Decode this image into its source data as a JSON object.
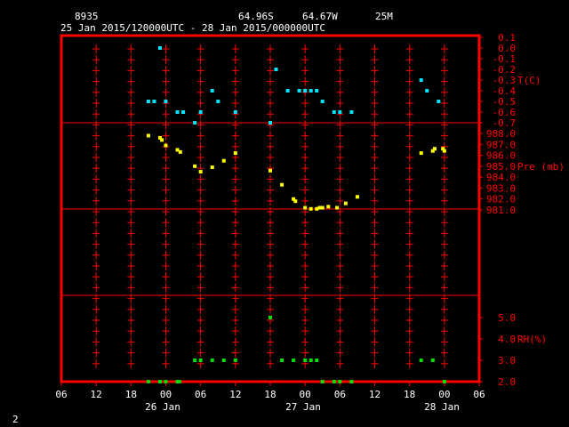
{
  "header": {
    "station": "8935",
    "lat": "64.96S",
    "lon": "64.67W",
    "elev": "25M",
    "range": "25 Jan 2015/120000UTC - 28 Jan 2015/000000UTC"
  },
  "footer": {
    "page": "2"
  },
  "colors": {
    "axes": "#ff0000",
    "text": "#ffffff",
    "temp": "#00e5ff",
    "pres": "#ffff00",
    "rh": "#00e000"
  },
  "chart_data": [
    {
      "type": "scatter",
      "panel": "temperature",
      "ylabel": "T(C)",
      "ylim": [
        -0.7,
        0.1
      ],
      "ticks": [
        "0.1",
        "0.0",
        "-0.1",
        "-0.2",
        "-0.3",
        "-0.4",
        "-0.5",
        "-0.6",
        "-0.7"
      ],
      "x": [
        "2015-01-25T21:00",
        "2015-01-25T22:00",
        "2015-01-25T23:00",
        "2015-01-26T00:00",
        "2015-01-26T02:00",
        "2015-01-26T03:00",
        "2015-01-26T05:00",
        "2015-01-26T06:00",
        "2015-01-26T08:00",
        "2015-01-26T09:00",
        "2015-01-26T12:00",
        "2015-01-26T18:00",
        "2015-01-26T19:00",
        "2015-01-26T21:00",
        "2015-01-26T23:00",
        "2015-01-27T00:00",
        "2015-01-27T01:00",
        "2015-01-27T02:00",
        "2015-01-27T03:00",
        "2015-01-27T05:00",
        "2015-01-27T06:00",
        "2015-01-27T08:00",
        "2015-01-27T20:00",
        "2015-01-27T21:00",
        "2015-01-27T23:00"
      ],
      "values": [
        -0.5,
        -0.5,
        0.0,
        -0.5,
        -0.6,
        -0.6,
        -0.7,
        -0.6,
        -0.4,
        -0.5,
        -0.6,
        -0.7,
        -0.2,
        -0.4,
        -0.4,
        -0.4,
        -0.4,
        -0.4,
        -0.5,
        -0.6,
        -0.6,
        -0.6,
        -0.3,
        -0.4,
        -0.5
      ]
    },
    {
      "type": "scatter",
      "panel": "pressure",
      "ylabel": "Pre (mb)",
      "ylim": [
        981.0,
        988.0
      ],
      "ticks": [
        "988.0",
        "987.0",
        "986.0",
        "985.0",
        "984.0",
        "983.0",
        "982.0",
        "981.0"
      ],
      "x": [
        "2015-01-25T21:00",
        "2015-01-25T23:00",
        "2015-01-25T23:20",
        "2015-01-26T00:00",
        "2015-01-26T02:00",
        "2015-01-26T02:30",
        "2015-01-26T05:00",
        "2015-01-26T06:00",
        "2015-01-26T08:00",
        "2015-01-26T10:00",
        "2015-01-26T12:00",
        "2015-01-26T18:00",
        "2015-01-26T20:00",
        "2015-01-26T22:00",
        "2015-01-26T22:20",
        "2015-01-27T00:00",
        "2015-01-27T01:00",
        "2015-01-27T02:00",
        "2015-01-27T02:30",
        "2015-01-27T03:00",
        "2015-01-27T04:00",
        "2015-01-27T05:30",
        "2015-01-27T07:00",
        "2015-01-27T09:00",
        "2015-01-27T20:00",
        "2015-01-27T22:00",
        "2015-01-27T22:20",
        "2015-01-27T23:45",
        "2015-01-28T00:00"
      ],
      "values": [
        987.8,
        987.6,
        987.4,
        986.9,
        986.5,
        986.3,
        985.0,
        984.5,
        984.9,
        985.5,
        986.2,
        984.6,
        983.3,
        982.0,
        981.8,
        981.2,
        981.1,
        981.1,
        981.2,
        981.2,
        981.3,
        981.2,
        981.6,
        982.2,
        986.2,
        986.4,
        986.6,
        986.6,
        986.4
      ]
    },
    {
      "type": "scatter",
      "panel": "relative humidity",
      "ylabel": "RH(%)",
      "ylim": [
        2.0,
        5.0
      ],
      "ticks": [
        "5.0",
        "4.0",
        "3.0",
        "2.0"
      ],
      "x": [
        "2015-01-25T21:00",
        "2015-01-25T23:00",
        "2015-01-26T00:00",
        "2015-01-26T02:00",
        "2015-01-26T02:20",
        "2015-01-26T05:00",
        "2015-01-26T06:00",
        "2015-01-26T08:00",
        "2015-01-26T10:00",
        "2015-01-26T12:00",
        "2015-01-26T18:00",
        "2015-01-26T20:00",
        "2015-01-26T22:00",
        "2015-01-27T00:00",
        "2015-01-27T01:00",
        "2015-01-27T02:00",
        "2015-01-27T03:00",
        "2015-01-27T05:00",
        "2015-01-27T06:00",
        "2015-01-27T08:00",
        "2015-01-27T20:00",
        "2015-01-27T22:00",
        "2015-01-28T00:00"
      ],
      "values": [
        2.0,
        2.0,
        2.0,
        2.0,
        2.0,
        3.0,
        3.0,
        3.0,
        3.0,
        3.0,
        5.0,
        3.0,
        3.0,
        3.0,
        3.0,
        3.0,
        2.0,
        2.0,
        2.0,
        2.0,
        3.0,
        3.0,
        2.0
      ]
    }
  ],
  "x_axis": {
    "range": [
      "2015-01-25T06:00",
      "2015-01-28T06:00"
    ],
    "tick_labels": [
      "06",
      "12",
      "18",
      "00",
      "06",
      "12",
      "18",
      "00",
      "06",
      "12",
      "18",
      "00",
      "06"
    ],
    "date_labels": [
      "26 Jan",
      "27 Jan",
      "28 Jan"
    ]
  }
}
